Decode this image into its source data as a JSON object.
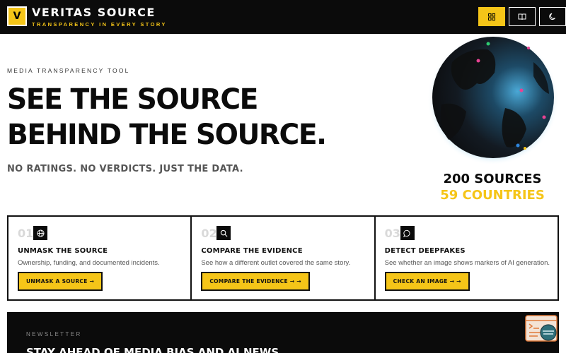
{
  "brand": {
    "logo_letter": "V",
    "title": "VERITAS SOURCE",
    "tagline": "TRANSPARENCY IN EVERY STORY"
  },
  "header_buttons": [
    {
      "icon": "grid-icon",
      "active": true
    },
    {
      "icon": "book-icon",
      "active": false
    },
    {
      "icon": "moon-icon",
      "active": false
    }
  ],
  "hero": {
    "eyebrow": "MEDIA TRANSPARENCY TOOL",
    "title": "SEE THE SOURCE BEHIND THE SOURCE.",
    "subtitle": "NO RATINGS. NO VERDICTS. JUST THE DATA."
  },
  "stats": {
    "sources": "200 SOURCES",
    "countries": "59 COUNTRIES"
  },
  "cards": [
    {
      "number": "01",
      "icon": "globe-icon",
      "title": "UNMASK THE SOURCE",
      "description": "Ownership, funding, and documented incidents.",
      "button": "UNMASK A SOURCE →"
    },
    {
      "number": "02",
      "icon": "search-icon",
      "title": "COMPARE THE EVIDENCE",
      "description": "See how a different outlet covered the same story.",
      "button": "COMPARE THE EVIDENCE → →"
    },
    {
      "number": "03",
      "icon": "chat-bubble-icon",
      "title": "DETECT DEEPFAKES",
      "description": "See whether an image shows markers of AI generation.",
      "button": "CHECK AN IMAGE → →"
    }
  ],
  "newsletter": {
    "label": "NEWSLETTER",
    "title": "STAY AHEAD OF MEDIA BIAS AND AI NEWS"
  },
  "colors": {
    "accent": "#f5c518",
    "dark": "#0b0b0b",
    "globe_glow": "#3aa0d8"
  }
}
